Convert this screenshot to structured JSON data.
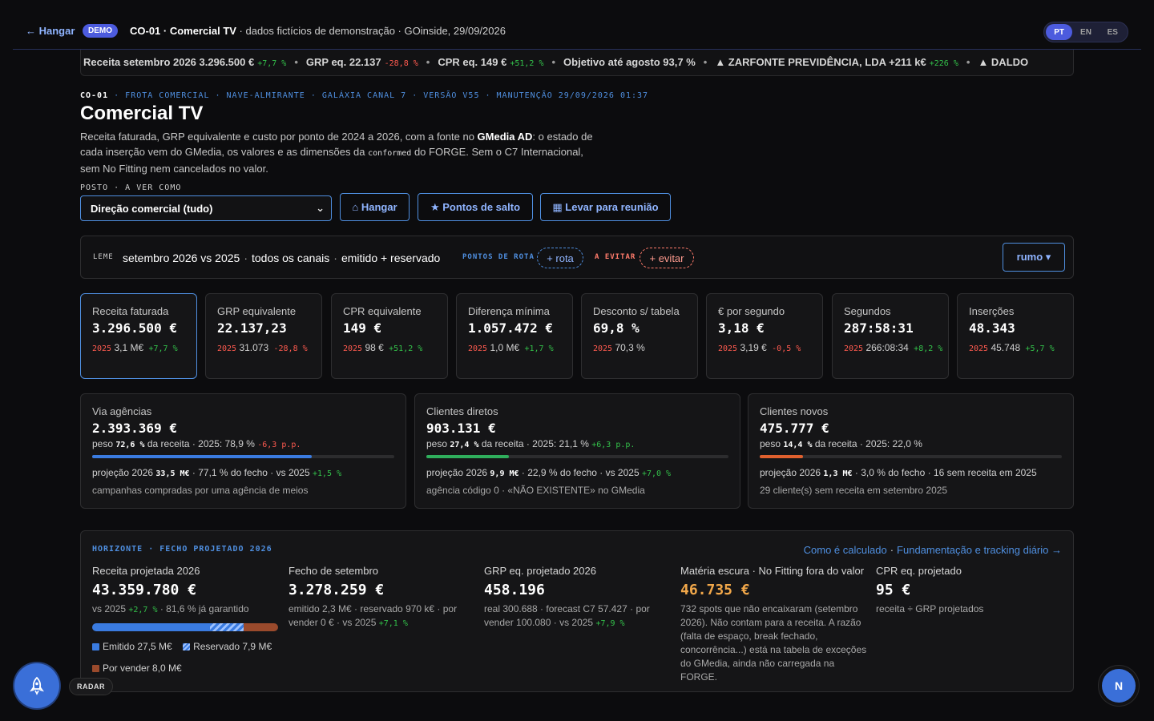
{
  "header": {
    "back_label": "← Hangar",
    "demo_badge": "DEMO",
    "crumb_title": "CO-01 · Comercial TV",
    "crumb_rest": " · dados fictícios de demonstração · GOinside, 29/09/2026",
    "langs": [
      "PT",
      "EN",
      "ES"
    ],
    "active_lang": "PT"
  },
  "ticker": {
    "items": [
      {
        "text": "Receita setembro 2026 3.296.500 €",
        "delta": "+7,7 %",
        "tone": "green"
      },
      {
        "text": "GRP eq. 22.137",
        "delta": "-28,8 %",
        "tone": "red"
      },
      {
        "text": "CPR eq. 149 €",
        "delta": "+51,2 %",
        "tone": "green"
      },
      {
        "text": "Objetivo até agosto 93,7 %",
        "delta": "",
        "tone": ""
      },
      {
        "text": "▲ ZARFONTE PREVIDÊNCIA, LDA +211 k€",
        "delta": "+226 %",
        "tone": "green"
      },
      {
        "text": "▲ DALDO",
        "delta": "",
        "tone": ""
      }
    ]
  },
  "page": {
    "eyebrow_code": "CO-01",
    "eyebrow_rest": " · FROTA COMERCIAL · NAVE-ALMIRANTE · GALÁXIA CANAL 7 · VERSÃO V55 · MANUTENÇÃO 29/09/2026 01:37",
    "title": "Comercial TV",
    "desc_1": "Receita faturada, GRP equivalente e custo por ponto de 2024 a 2026, com a fonte no ",
    "desc_bold": "GMedia AD",
    "desc_2": ": o estado de cada inserção vem do GMedia, os valores e as dimensões da ",
    "desc_code": "conformed",
    "desc_3": " do FORGE. Sem o C7 Internacional, sem No Fitting nem cancelados no valor.",
    "posto_label": "POSTO · A VER COMO",
    "select_value": "Direção comercial (tudo)",
    "btn_hangar": "⌂ Hangar",
    "btn_pontos": "★ Pontos de salto",
    "btn_reuniao": "▦ Levar para reunião"
  },
  "leme": {
    "label": "LEME",
    "period": "setembro 2026 vs 2025",
    "channels": "todos os canais",
    "status": "emitido + reservado",
    "route_tag": "PONTOS DE ROTA",
    "route_pill": "+ rota",
    "avoid_tag": "A EVITAR",
    "avoid_pill": "+ evitar",
    "rumo": "rumo ▾"
  },
  "kpis": [
    {
      "label": "Receita faturada",
      "value": "3.296.500 €",
      "year": "2025",
      "prev": "3,1 M€",
      "delta": "+7,7 %",
      "tone": "green"
    },
    {
      "label": "GRP equivalente",
      "value": "22.137,23",
      "year": "2025",
      "prev": "31.073",
      "delta": "-28,8 %",
      "tone": "red"
    },
    {
      "label": "CPR equivalente",
      "value": "149 €",
      "year": "2025",
      "prev": "98 €",
      "delta": "+51,2 %",
      "tone": "green"
    },
    {
      "label": "Diferença mínima",
      "value": "1.057.472 €",
      "year": "2025",
      "prev": "1,0 M€",
      "delta": "+1,7 %",
      "tone": "green"
    },
    {
      "label": "Desconto s/ tabela",
      "value": "69,8 %",
      "year": "2025",
      "prev": "70,3 %",
      "delta": "",
      "tone": ""
    },
    {
      "label": "€ por segundo",
      "value": "3,18 €",
      "year": "2025",
      "prev": "3,19 €",
      "delta": "-0,5 %",
      "tone": "red"
    },
    {
      "label": "Segundos",
      "value": "287:58:31",
      "year": "2025",
      "prev": "266:08:34",
      "delta": "+8,2 %",
      "tone": "green"
    },
    {
      "label": "Inserções",
      "value": "48.343",
      "year": "2025",
      "prev": "45.748",
      "delta": "+5,7 %",
      "tone": "green"
    }
  ],
  "channels": [
    {
      "label": "Via agências",
      "value": "2.393.369 €",
      "peso_pre": "peso ",
      "peso": "72,6 %",
      "peso_post": " da receita · 2025: 78,9 % ",
      "peso_delta": "-6,3 p.p.",
      "peso_tone": "red",
      "share": 0.726,
      "color": "#3a7be0",
      "proj_pre": "projeção 2026 ",
      "proj": "33,5 M€",
      "proj_post": " · 77,1 % do fecho · vs 2025 ",
      "proj_delta": "+1,5 %",
      "note": "campanhas compradas por uma agência de meios"
    },
    {
      "label": "Clientes diretos",
      "value": "903.131 €",
      "peso_pre": "peso ",
      "peso": "27,4 %",
      "peso_post": " da receita · 2025: 21,1 % ",
      "peso_delta": "+6,3 p.p.",
      "peso_tone": "green",
      "share": 0.274,
      "color": "#2fae5c",
      "proj_pre": "projeção 2026 ",
      "proj": "9,9 M€",
      "proj_post": " · 22,9 % do fecho · vs 2025 ",
      "proj_delta": "+7,0 %",
      "note": "agência código 0 · «NÃO EXISTENTE» no GMedia"
    },
    {
      "label": "Clientes novos",
      "value": "475.777 €",
      "peso_pre": "peso ",
      "peso": "14,4 %",
      "peso_post": " da receita · 2025: 22,0 %",
      "peso_delta": "",
      "peso_tone": "",
      "share": 0.144,
      "color": "#e0602e",
      "proj_pre": "projeção 2026 ",
      "proj": "1,3 M€",
      "proj_post": " · 3,0 % do fecho · 16 sem receita em 2025",
      "proj_delta": "",
      "note": "29 cliente(s) sem receita em setembro 2025"
    }
  ],
  "horizonte": {
    "eyebrow": "HORIZONTE · FECHO PROJETADO 2026",
    "link_calc": "Como é calculado",
    "link_track": "Fundamentação e tracking diário →",
    "receita": {
      "label": "Receita projetada 2026",
      "value": "43.359.780 €",
      "sub_pre": "vs 2025 ",
      "sub_delta": "+2,7 %",
      "sub_post": " · 81,6 % já garantido",
      "emitido": 27.5,
      "reservado": 7.9,
      "por_vender": 8.0,
      "leg_emitido": "Emitido 27,5 M€",
      "leg_reservado": "Reservado 7,9 M€",
      "leg_por_vender": "Por vender 8,0 M€"
    },
    "setembro": {
      "label": "Fecho de setembro",
      "value": "3.278.259 €",
      "sub": "emitido 2,3 M€ · reservado 970 k€ · por vender 0 € · vs 2025 ",
      "sub_delta": "+7,1 %"
    },
    "grp": {
      "label": "GRP eq. projetado 2026",
      "value": "458.196",
      "sub": "real 300.688 · forecast C7 57.427 · por vender 100.080 · vs 2025 ",
      "sub_delta": "+7,9 %"
    },
    "materia": {
      "label": "Matéria escura · No Fitting fora do valor",
      "value": "46.735 €",
      "sub": "732 spots que não encaixaram (setembro 2026). Não contam para a receita. A razão (falta de espaço, break fechado, concorrência...) está na tabela de exceções do GMedia, ainda não carregada na FORGE."
    },
    "cpr": {
      "label": "CPR eq. projetado",
      "value": "95 €",
      "sub": "receita ÷ GRP projetados"
    }
  },
  "float": {
    "radar_label": "RADAR",
    "avatar_initial": "N"
  },
  "colors": {
    "accent": "#4f8fe0",
    "green": "#33c04a",
    "red": "#ff5a4f",
    "orange": "#f2a84a",
    "emitido": "#3a7be0",
    "por_vender": "#9a4a2c"
  }
}
